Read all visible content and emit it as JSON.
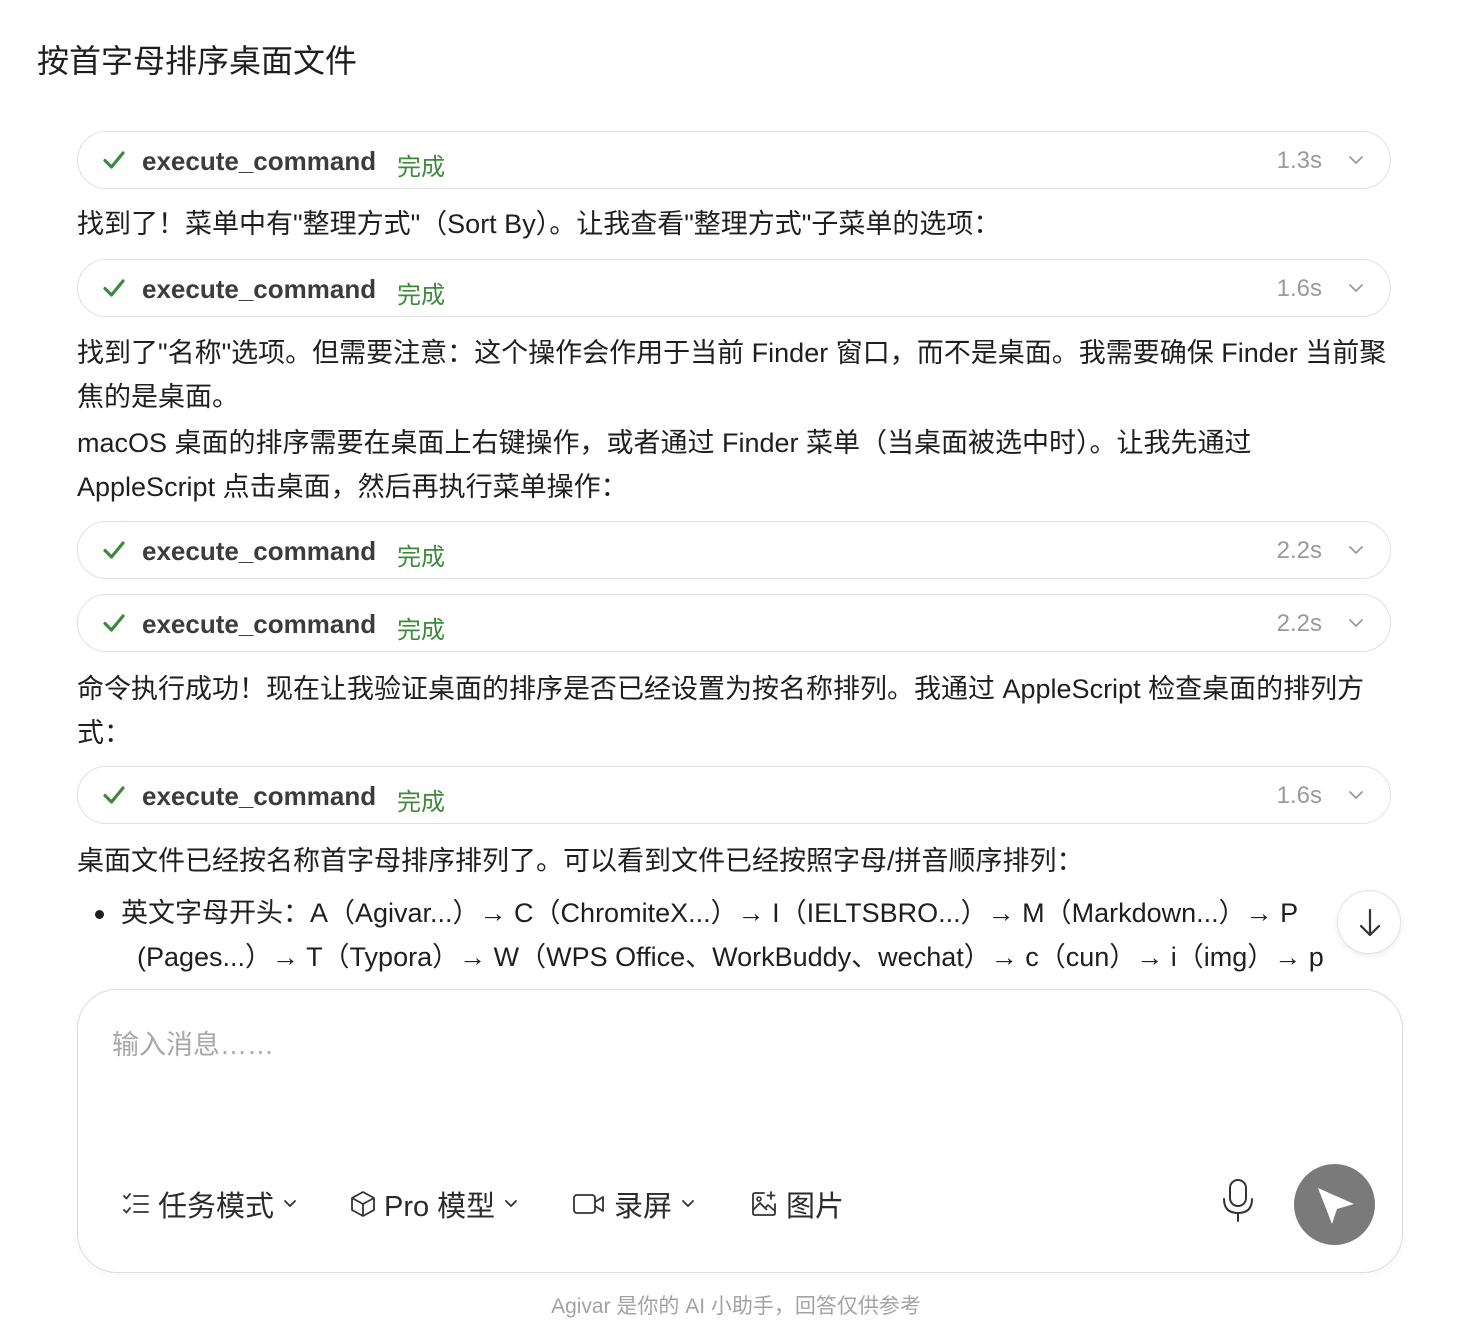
{
  "page": {
    "title": "按首字母排序桌面文件"
  },
  "tool_calls": [
    {
      "name": "execute_command",
      "status": "完成",
      "duration": "1.3s"
    },
    {
      "name": "execute_command",
      "status": "完成",
      "duration": "1.6s"
    },
    {
      "name": "execute_command",
      "status": "完成",
      "duration": "2.2s"
    },
    {
      "name": "execute_command",
      "status": "完成",
      "duration": "2.2s"
    },
    {
      "name": "execute_command",
      "status": "完成",
      "duration": "1.6s"
    }
  ],
  "messages": {
    "m1": "找到了！菜单中有\"整理方式\"（Sort By）。让我查看\"整理方式\"子菜单的选项：",
    "m2_line1": "找到了\"名称\"选项。但需要注意：这个操作会作用于当前 Finder 窗口，而不是桌面。我需要确保 Finder 当前聚焦的是桌面。",
    "m2_line2": "macOS 桌面的排序需要在桌面上右键操作，或者通过 Finder 菜单（当桌面被选中时）。让我先通过 AppleScript 点击桌面，然后再执行菜单操作：",
    "m3": "命令执行成功！现在让我验证桌面的排序是否已经设置为按名称排列。我通过 AppleScript 检查桌面的排列方式：",
    "m4": "桌面文件已经按名称首字母排序排列了。可以看到文件已经按照字母/拼音顺序排列：",
    "bullet1_line1": "英文字母开头：A（Agivar...）→ C（ChromiteX...）→ I（IELTSBRO...）→ M（Markdown...）→ P",
    "bullet1_line2": "(Pages...）→ T（Typora）→ W（WPS Office、WorkBuddy、wechat）→ c（cun）→ i（img）→ p"
  },
  "composer": {
    "placeholder": "输入消息……",
    "task_mode_label": "任务模式",
    "model_label": "Pro 模型",
    "record_label": "录屏",
    "image_label": "图片"
  },
  "footer": {
    "text": "Agivar 是你的 AI 小助手，回答仅供参考"
  },
  "colors": {
    "success": "#3e8a3c",
    "send_button": "#7a7a7a",
    "border": "#e1e1e1"
  }
}
